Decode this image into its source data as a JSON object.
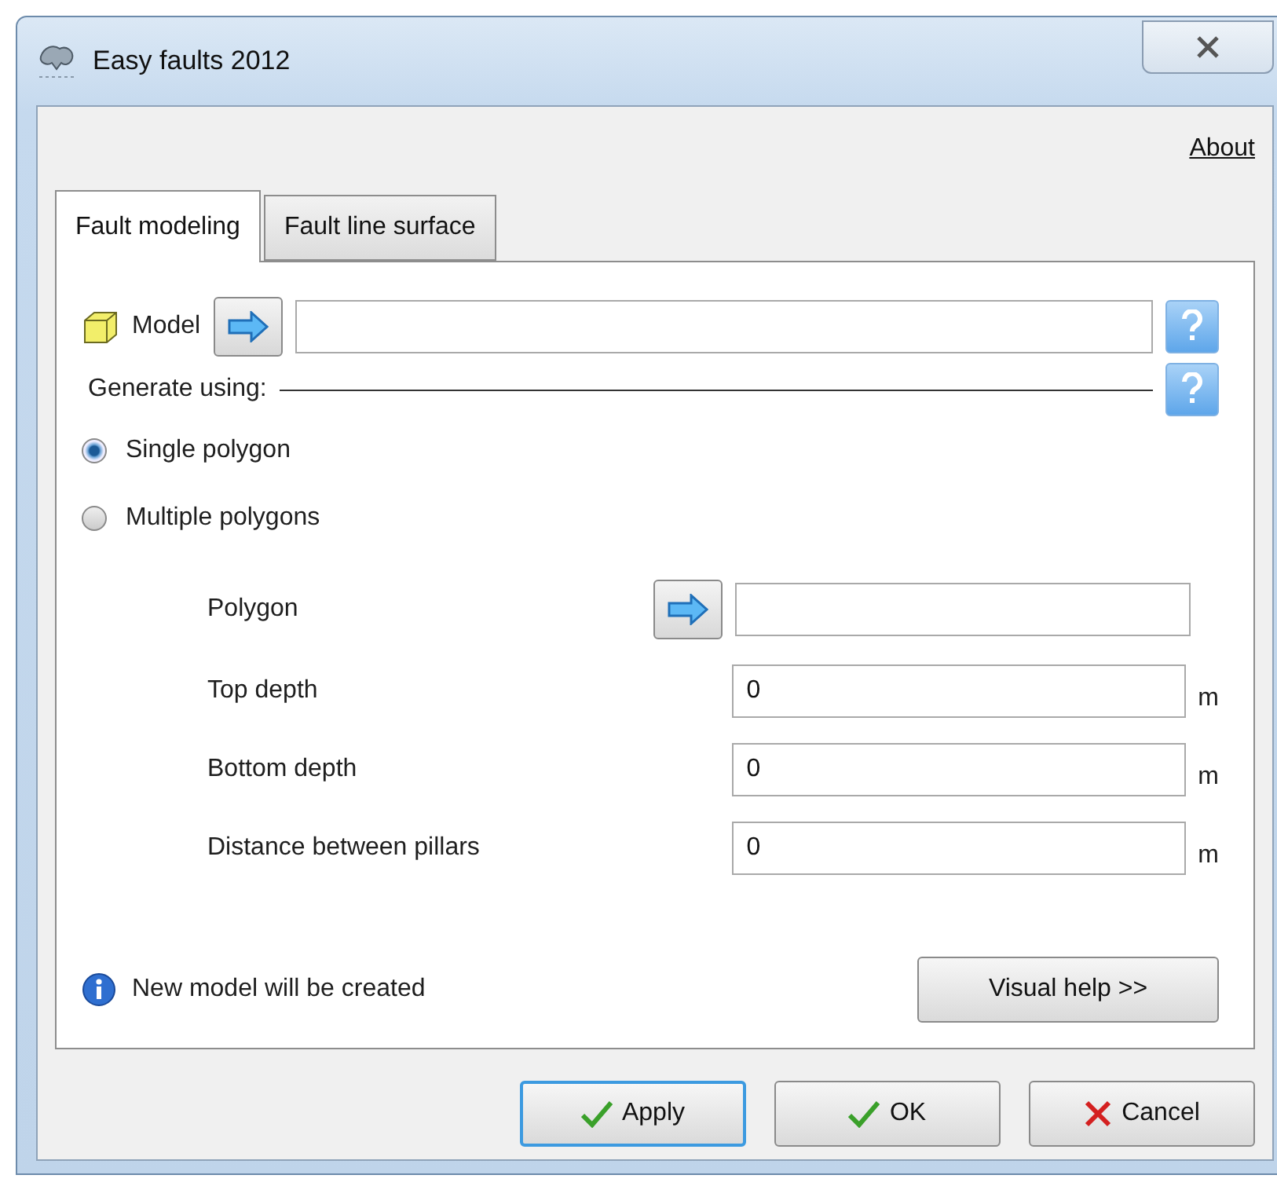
{
  "window": {
    "title": "Easy faults 2012"
  },
  "about_link": "About",
  "tabs": [
    {
      "label": "Fault modeling",
      "selected": true
    },
    {
      "label": "Fault line surface",
      "selected": false
    }
  ],
  "model": {
    "label": "Model"
  },
  "generate_using": {
    "label": "Generate using:"
  },
  "radios": [
    {
      "label": "Single polygon",
      "selected": true
    },
    {
      "label": "Multiple polygons",
      "selected": false
    }
  ],
  "fields": [
    {
      "kind": "picker",
      "label": "Polygon"
    },
    {
      "kind": "number",
      "label": "Top depth",
      "value": "0",
      "unit": "m"
    },
    {
      "kind": "number",
      "label": "Bottom depth",
      "value": "0",
      "unit": "m"
    },
    {
      "kind": "number",
      "label": "Distance between pillars",
      "value": "0",
      "unit": "m"
    }
  ],
  "info": "New model will be created",
  "visual_help": "Visual help >>",
  "buttons": [
    {
      "kind": "apply",
      "label": "Apply",
      "focused": true
    },
    {
      "kind": "ok",
      "label": "OK",
      "focused": false
    },
    {
      "kind": "cancel",
      "label": "Cancel",
      "focused": false
    }
  ]
}
